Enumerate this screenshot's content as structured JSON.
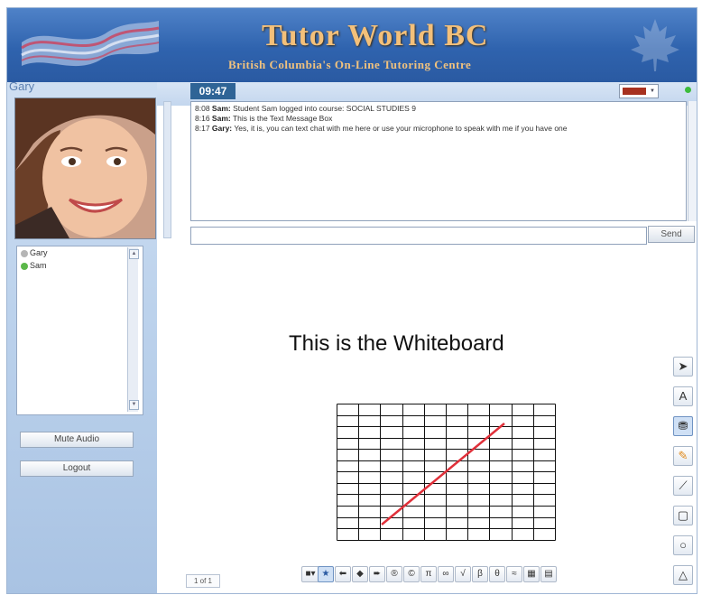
{
  "header": {
    "title": "Tutor World BC",
    "subtitle": "British Columbia's On-Line Tutoring Centre"
  },
  "video": {
    "user_name": "Gary"
  },
  "chat": {
    "clock": "09:47",
    "pen_color": "#a7311f",
    "messages": [
      {
        "time": "8:08",
        "sender": "Sam:",
        "text": "Student Sam logged into course: SOCIAL STUDIES 9"
      },
      {
        "time": "8:16",
        "sender": "Sam:",
        "text": "This is the Text Message Box"
      },
      {
        "time": "8:17",
        "sender": "Gary:",
        "text": "Yes, it is, you can text chat with me here or use your microphone to speak with me if you have one"
      }
    ],
    "input_value": "",
    "send_label": "Send"
  },
  "users": [
    {
      "name": "Gary",
      "status_color": "#b5b5b5"
    },
    {
      "name": "Sam",
      "status_color": "#5cb84a"
    }
  ],
  "buttons": {
    "mute_audio": "Mute Audio",
    "logout": "Logout"
  },
  "whiteboard": {
    "text": "This is the Whiteboard",
    "page_indicator": "1 of 1",
    "line_color": "#e0303a"
  },
  "toolbar_right": [
    {
      "name": "select-tool-icon",
      "glyph": "➤"
    },
    {
      "name": "text-tool-icon",
      "glyph": "A"
    },
    {
      "name": "stamp-tool-icon",
      "glyph": "⛃"
    },
    {
      "name": "pencil-tool-icon",
      "glyph": "✎"
    },
    {
      "name": "line-tool-icon",
      "glyph": "⟋"
    },
    {
      "name": "rectangle-tool-icon",
      "glyph": "▢"
    },
    {
      "name": "circle-tool-icon",
      "glyph": "○"
    },
    {
      "name": "triangle-tool-icon",
      "glyph": "△"
    }
  ],
  "toolbar_bottom": [
    {
      "name": "shape-dropdown-icon",
      "glyph": "■▾"
    },
    {
      "name": "star-icon",
      "glyph": "★"
    },
    {
      "name": "arrow-left-icon",
      "glyph": "⬅"
    },
    {
      "name": "diamond-icon",
      "glyph": "◆"
    },
    {
      "name": "arrow-right-icon",
      "glyph": "➨"
    },
    {
      "name": "registered-icon",
      "glyph": "®"
    },
    {
      "name": "copyright-icon",
      "glyph": "©"
    },
    {
      "name": "pi-icon",
      "glyph": "π"
    },
    {
      "name": "infinity-icon",
      "glyph": "∞"
    },
    {
      "name": "square-root-icon",
      "glyph": "√"
    },
    {
      "name": "beta-icon",
      "glyph": "β"
    },
    {
      "name": "theta-icon",
      "glyph": "θ"
    },
    {
      "name": "approx-icon",
      "glyph": "≈"
    },
    {
      "name": "grid-icon",
      "glyph": "▦"
    },
    {
      "name": "table-icon",
      "glyph": "▤"
    }
  ]
}
